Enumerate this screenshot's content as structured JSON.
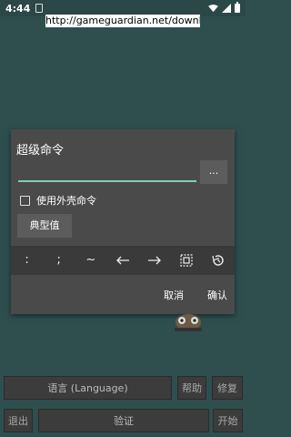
{
  "status_bar": {
    "time": "4:44",
    "icons": [
      "sim-card-icon",
      "wifi-icon",
      "signal-icon",
      "battery-icon"
    ]
  },
  "url_banner": "http://gameguardian.net/download",
  "dialog": {
    "title": "超级命令",
    "input_value": "",
    "more_label": "...",
    "shell_checkbox_label": "使用外壳命令",
    "shell_checked": false,
    "typical_label": "典型值",
    "symbols": [
      ":",
      ";",
      "~"
    ],
    "cancel_label": "取消",
    "confirm_label": "确认"
  },
  "bottom": {
    "language_label": "语言 (Language)",
    "help_label": "帮助",
    "repair_label": "修复",
    "exit_label": "退出",
    "verify_label": "验证",
    "start_label": "开始"
  },
  "colors": {
    "background": "#2f4f4f",
    "dialog": "#4a4a4a",
    "accent": "#7fcfb8"
  }
}
